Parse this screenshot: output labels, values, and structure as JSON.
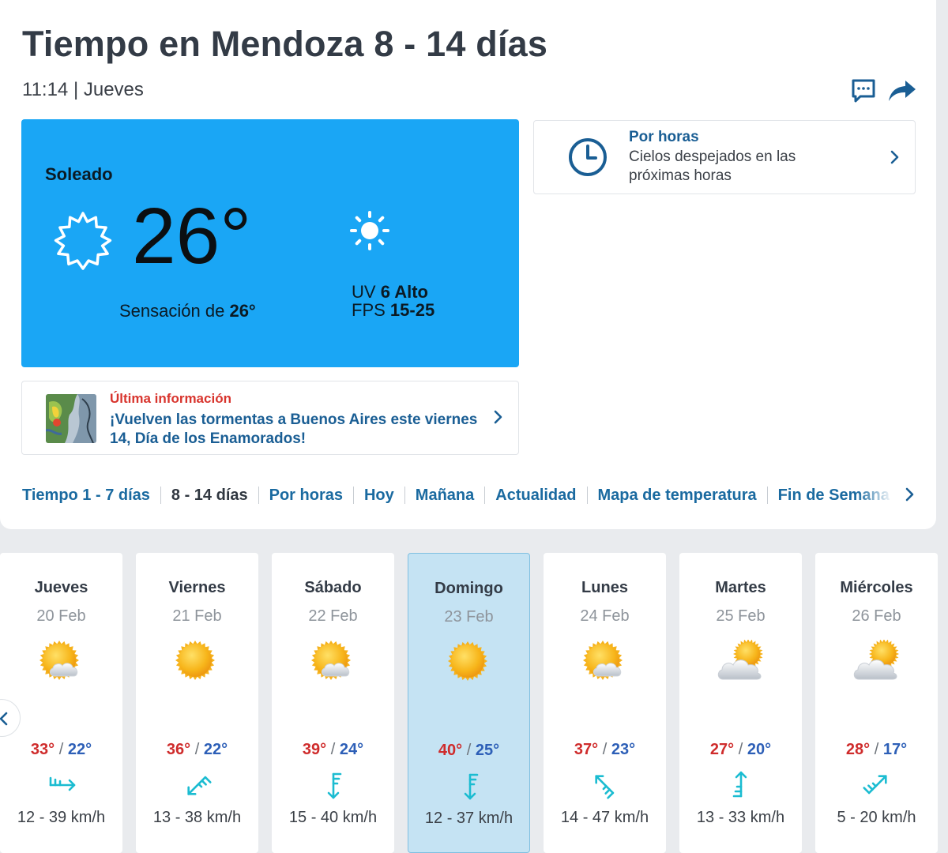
{
  "header": {
    "title": "Tiempo en Mendoza 8 - 14 días",
    "time": "11:14",
    "separator": "|",
    "weekday": "Jueves"
  },
  "current": {
    "condition": "Soleado",
    "temperature": "26°",
    "feels_label": "Sensación de",
    "feels_value": "26°",
    "uv_label": "UV",
    "uv_value": "6 Alto",
    "fps_label": "FPS",
    "fps_value": "15-25",
    "background": "#1aa6f5"
  },
  "hourly_card": {
    "title": "Por horas",
    "text": "Cielos despejados en las próximas horas"
  },
  "news": {
    "kicker": "Última información",
    "title": "¡Vuelven las tormentas a Buenos Aires este viernes 14, Día de los Enamorados!"
  },
  "tabs": [
    {
      "label": "Tiempo 1 - 7 días",
      "active": false
    },
    {
      "label": "8 - 14 días",
      "active": true
    },
    {
      "label": "Por horas",
      "active": false
    },
    {
      "label": "Hoy",
      "active": false
    },
    {
      "label": "Mañana",
      "active": false
    },
    {
      "label": "Actualidad",
      "active": false
    },
    {
      "label": "Mapa de temperatura",
      "active": false
    },
    {
      "label": "Fin de Semana",
      "active": false
    }
  ],
  "forecast": [
    {
      "day": "Jueves",
      "date": "20 Feb",
      "icon": "sun-cloud-icon",
      "max": "33°",
      "min": "22°",
      "wind": "12 - 39 km/h",
      "wind_dir": "W",
      "selected": false
    },
    {
      "day": "Viernes",
      "date": "21 Feb",
      "icon": "sun-icon",
      "max": "36°",
      "min": "22°",
      "wind": "13 - 38 km/h",
      "wind_dir": "NE",
      "selected": false
    },
    {
      "day": "Sábado",
      "date": "22 Feb",
      "icon": "sun-cloud-icon",
      "max": "39°",
      "min": "24°",
      "wind": "15 - 40 km/h",
      "wind_dir": "N",
      "selected": false
    },
    {
      "day": "Domingo",
      "date": "23 Feb",
      "icon": "sun-icon",
      "max": "40°",
      "min": "25°",
      "wind": "12 - 37 km/h",
      "wind_dir": "N",
      "selected": true
    },
    {
      "day": "Lunes",
      "date": "24 Feb",
      "icon": "sun-cloud-icon",
      "max": "37°",
      "min": "23°",
      "wind": "14 - 47 km/h",
      "wind_dir": "SE",
      "selected": false
    },
    {
      "day": "Martes",
      "date": "25 Feb",
      "icon": "cloud-sun-icon",
      "max": "27°",
      "min": "20°",
      "wind": "13 - 33 km/h",
      "wind_dir": "S",
      "selected": false
    },
    {
      "day": "Miércoles",
      "date": "26 Feb",
      "icon": "cloud-sun-icon",
      "max": "28°",
      "min": "17°",
      "wind": "5 - 20 km/h",
      "wind_dir": "SW",
      "selected": false
    }
  ],
  "colors": {
    "link": "#1a6aa0",
    "max_temp": "#cf2c2c",
    "min_temp": "#2d5fb7",
    "wind_arrow": "#1bbcd1",
    "selected_day": "#c5e3f3"
  }
}
